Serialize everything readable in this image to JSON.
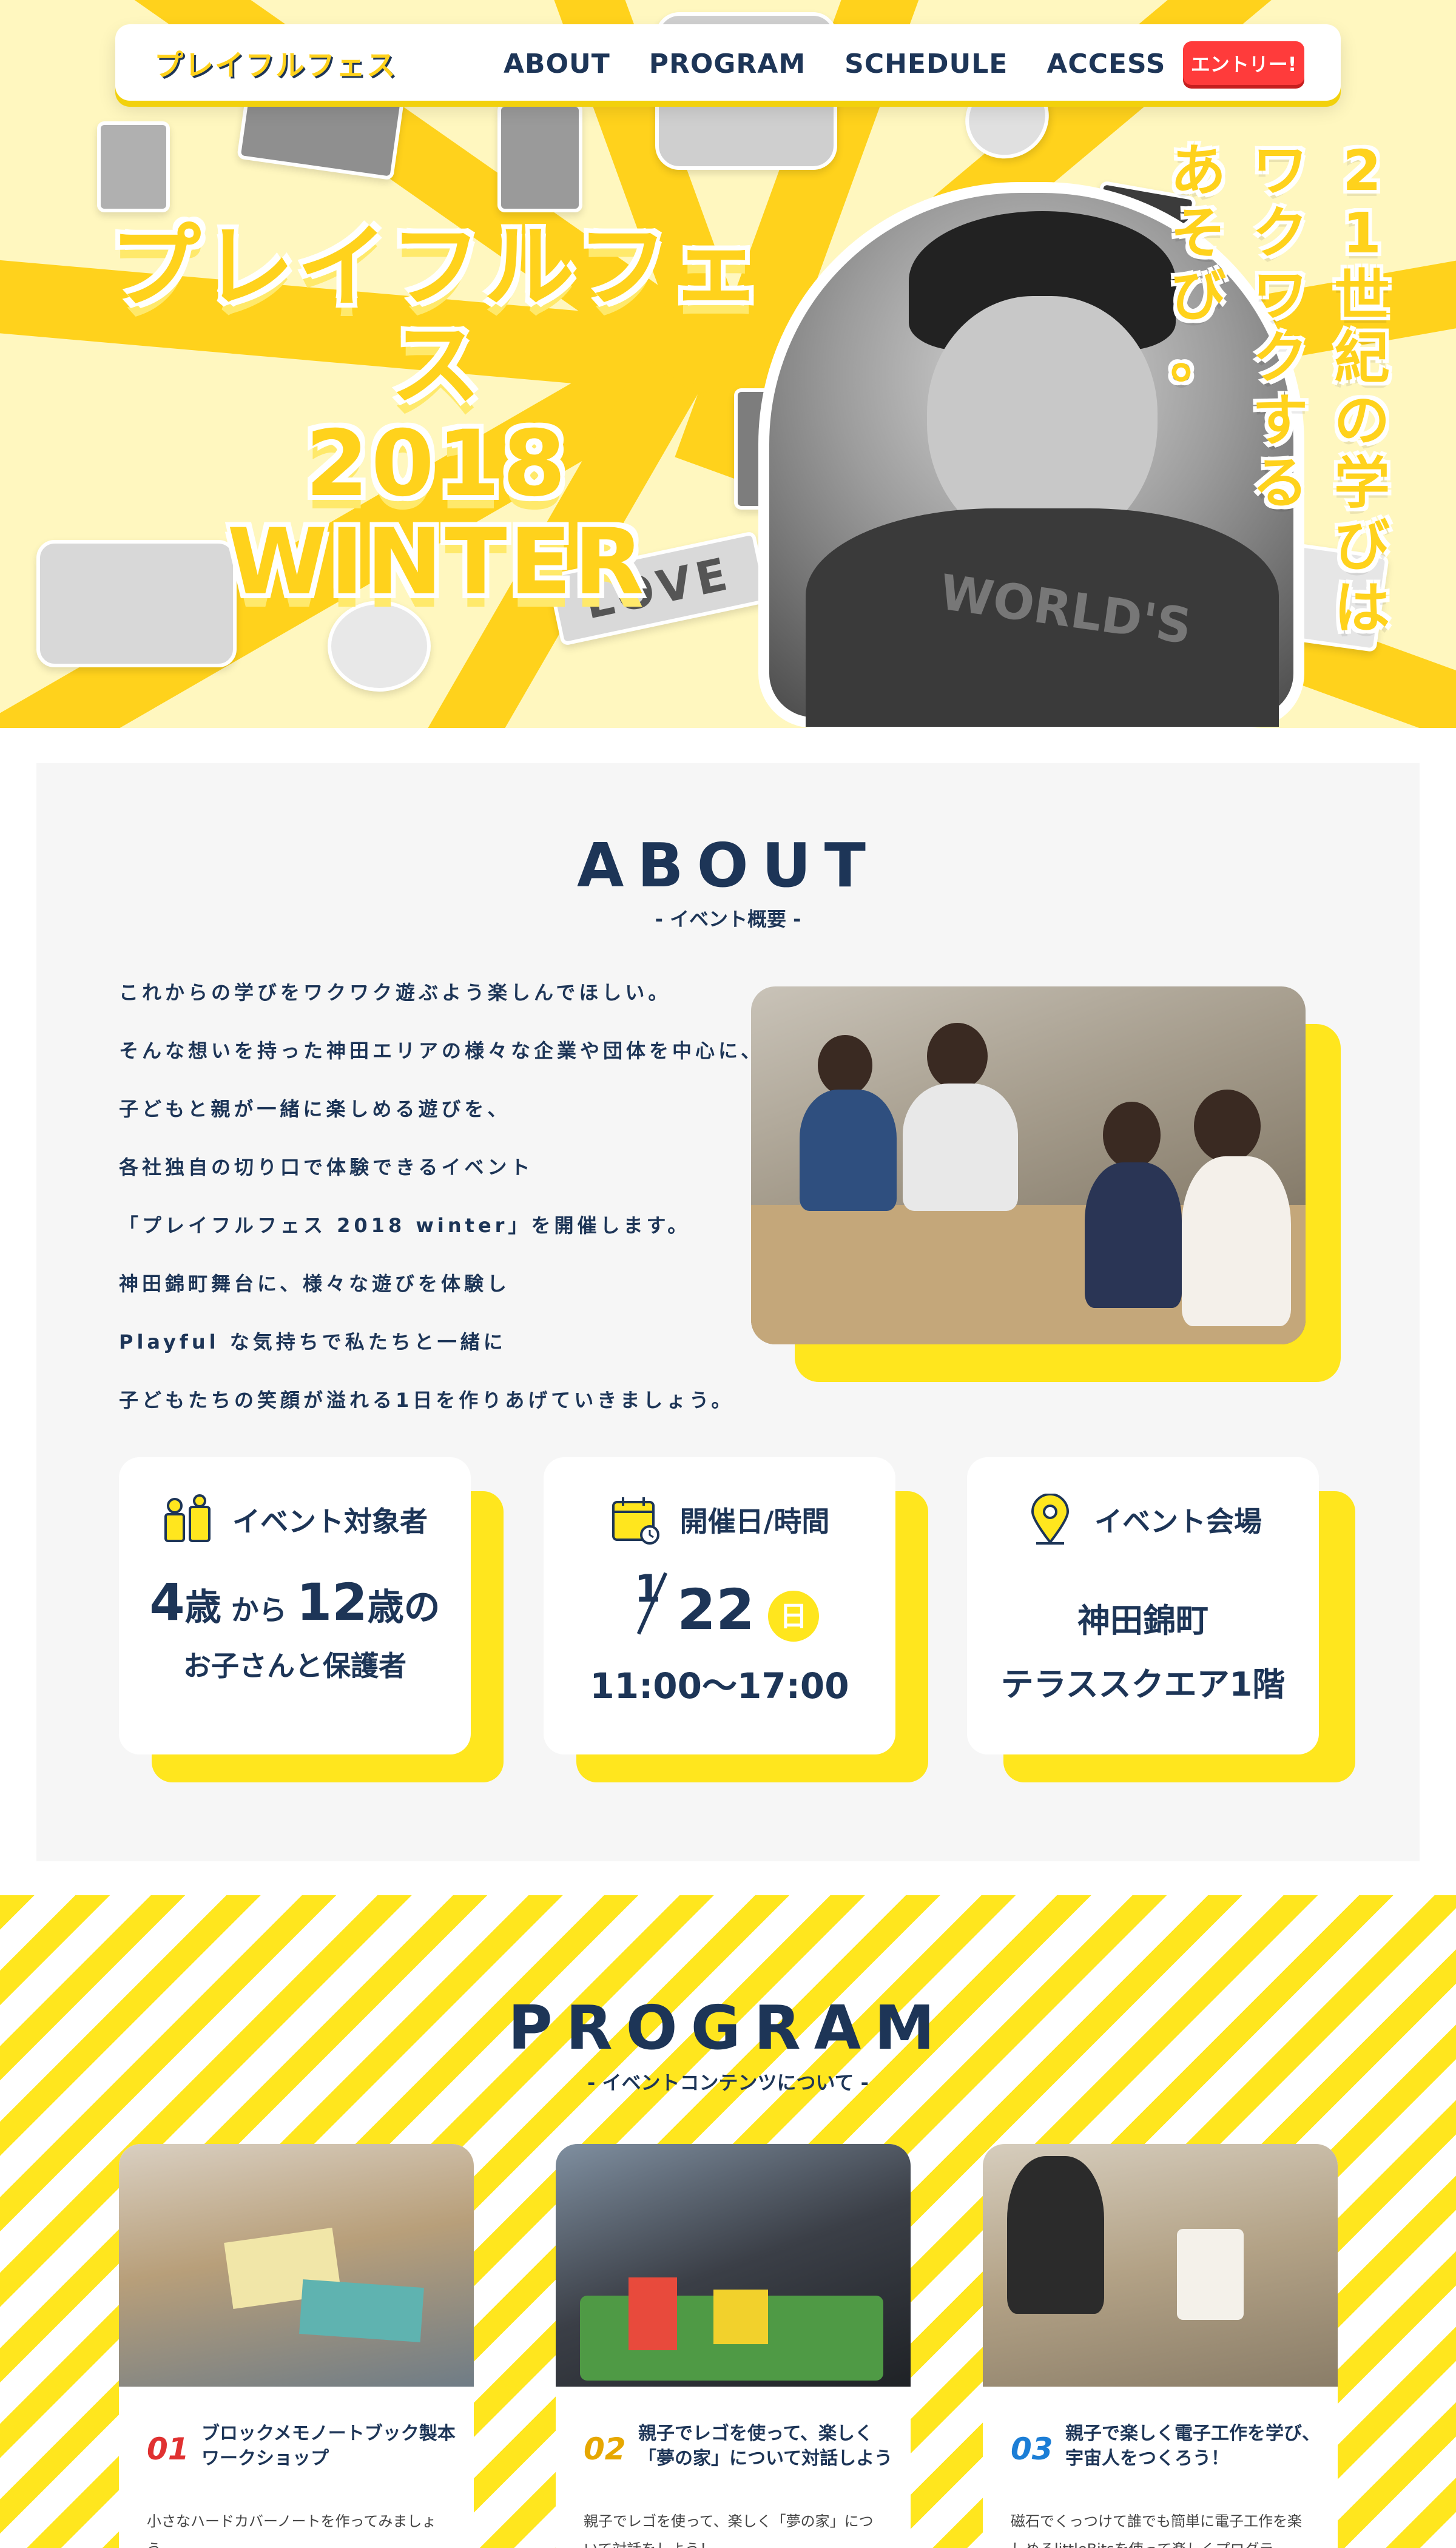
{
  "nav": {
    "logo": "プレイフルフェス",
    "items": [
      "ABOUT",
      "PROGRAM",
      "SCHEDULE",
      "ACCESS"
    ],
    "entry": "エントリー!"
  },
  "hero": {
    "title_line1": "プレイフルフェス",
    "title_line2": "2018",
    "title_line3": "WINTER",
    "copy_col1": "21世紀の学びは",
    "copy_col2": "ワクワクする",
    "copy_col3": "あそび。",
    "shirt_text": "WORLD'S",
    "love_text": "LOVE"
  },
  "about": {
    "title": "ABOUT",
    "subtitle": "- イベント概要 -",
    "lines": [
      "これからの学びをワクワク遊ぶよう楽しんでほしい。",
      "そんな想いを持った神田エリアの様々な企業や団体を中心に、",
      "子どもと親が一緒に楽しめる遊びを、",
      "各社独自の切り口で体験できるイベント",
      "「プレイフルフェス 2018 winter」を開催します。",
      "神田錦町舞台に、様々な遊びを体験し",
      "Playful な気持ちで私たちと一緒に",
      "子どもたちの笑顔が溢れる1日を作りあげていきましょう。"
    ],
    "cards": {
      "target": {
        "label": "イベント対象者",
        "age_from": "4",
        "unit1": "歳",
        "from_text": "から",
        "age_to": "12",
        "unit2": "歳の",
        "line2": "お子さんと保護者"
      },
      "date": {
        "label": "開催日/時間",
        "month": "1",
        "day": "22",
        "weekday": "日",
        "time": "11:00〜17:00"
      },
      "venue": {
        "label": "イベント会場",
        "line1": "神田錦町",
        "line2": "テラススクエア1階"
      }
    }
  },
  "program": {
    "title": "PROGRAM",
    "subtitle": "- イベントコンテンツについて -",
    "items": [
      {
        "num": "01",
        "title": "ブロックメモノートブック製本ワークショップ",
        "desc": "小さなハードカバーノートを作ってみましょう。"
      },
      {
        "num": "02",
        "title": "親子でレゴを使って、楽しく「夢の家」について対話しよう",
        "desc": "親子でレゴを使って、楽しく「夢の家」について対話をしよう！"
      },
      {
        "num": "03",
        "title": "親子で楽しく電子工作を学び、宇宙人をつくろう！",
        "desc": "磁石でくっつけて誰でも簡単に電子工作を楽しめるlittleBitsを使って楽しくプログラ……"
      }
    ]
  },
  "colors": {
    "navy": "#1d3557",
    "yellow": "#ffe61e",
    "title_yellow": "#ffd21c",
    "red": "#ff3b3b"
  }
}
